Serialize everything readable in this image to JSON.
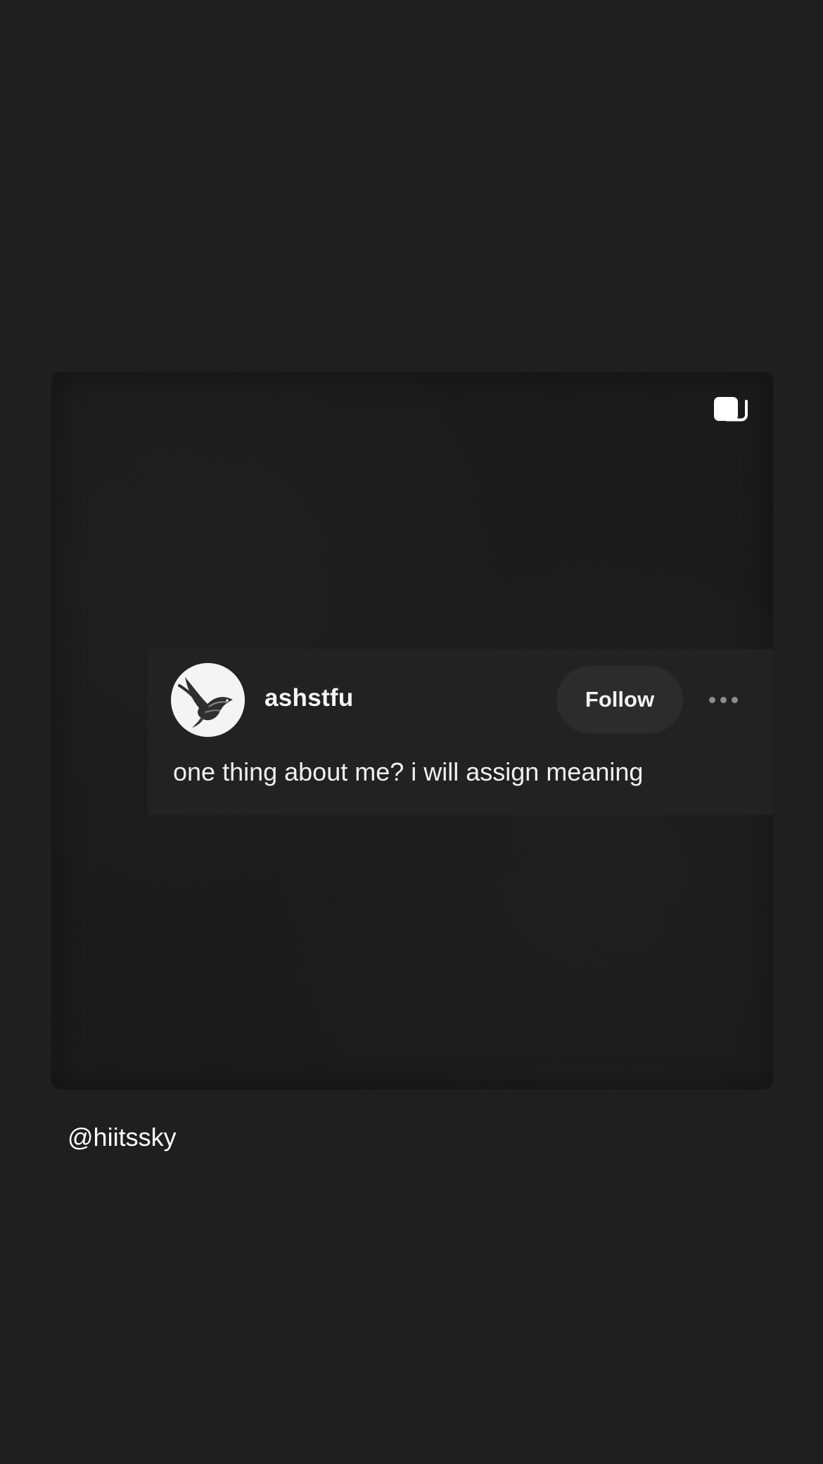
{
  "post": {
    "username": "ashstfu",
    "follow_label": "Follow",
    "text": "one thing about me? i will assign meaning",
    "avatar_icon": "swallow-bird-icon",
    "more_icon": "more-options-icon",
    "multi_media_icon": "multiple-images-icon"
  },
  "credit": {
    "handle": "@hiitssky"
  },
  "colors": {
    "background": "#1f1f1f",
    "card": "#1a1a1a",
    "panel": "#222222",
    "button": "#2c2c2c",
    "text": "#f2f2f2",
    "muted": "#8d8d8d"
  }
}
